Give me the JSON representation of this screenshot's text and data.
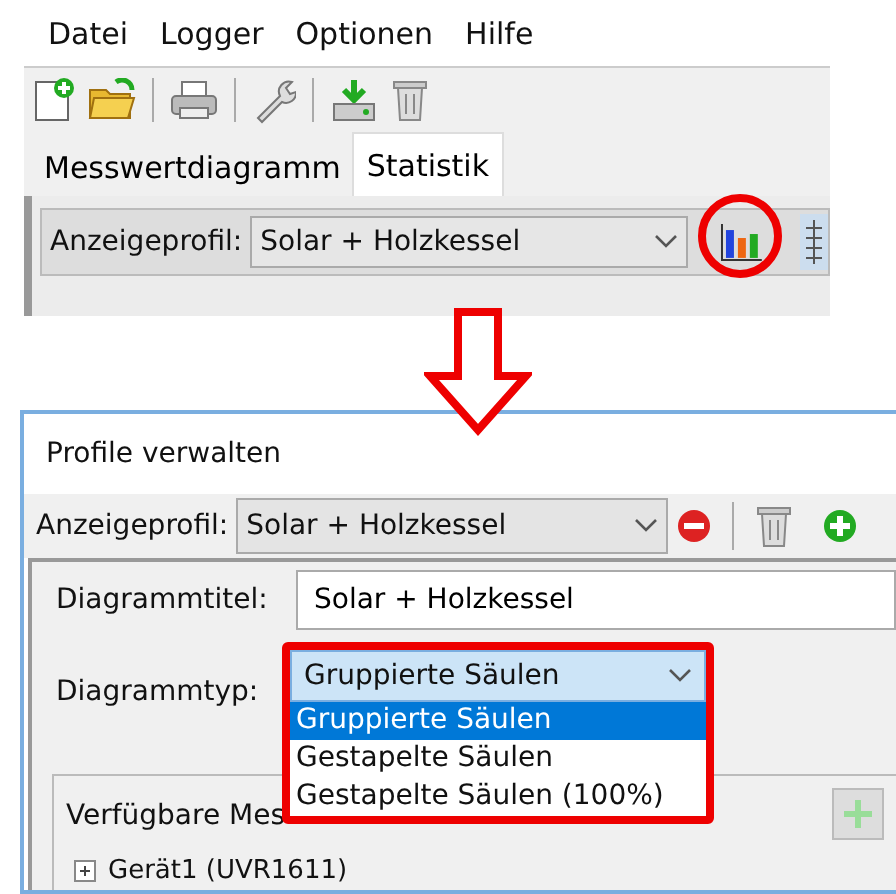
{
  "menu": [
    "Datei",
    "Logger",
    "Optionen",
    "Hilfe"
  ],
  "tabs": [
    {
      "label": "Messwertdiagramm",
      "selected": false
    },
    {
      "label": "Statistik",
      "selected": true
    }
  ],
  "profile_bar": {
    "label": "Anzeigeprofil:",
    "value": "Solar + Holzkessel"
  },
  "dialog": {
    "title": "Profile verwalten",
    "profile_bar": {
      "label": "Anzeigeprofil:",
      "value": "Solar + Holzkessel"
    },
    "diagram_title": {
      "label": "Diagrammtitel:",
      "value": "Solar + Holzkessel"
    },
    "diagram_type": {
      "label": "Diagrammtyp:",
      "value": "Gruppierte Säulen",
      "options": [
        {
          "label": "Gruppierte Säulen",
          "selected": true
        },
        {
          "label": "Gestapelte Säulen",
          "selected": false
        },
        {
          "label": "Gestapelte Säulen (100%)",
          "selected": false
        }
      ]
    },
    "group_label": "Verfügbare Mes",
    "tree": [
      {
        "label": "Gerät1 (UVR1611)",
        "expanded": false
      }
    ]
  }
}
